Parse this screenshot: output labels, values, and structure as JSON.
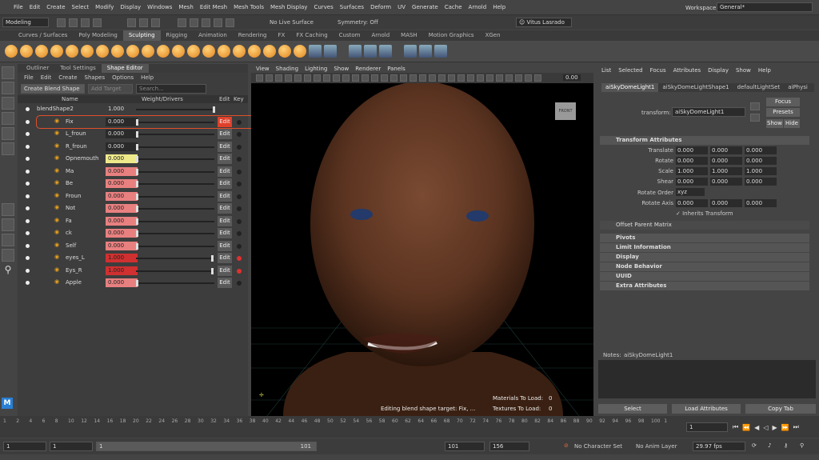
{
  "menubar": {
    "items": [
      "File",
      "Edit",
      "Create",
      "Select",
      "Modify",
      "Display",
      "Windows",
      "Mesh",
      "Edit Mesh",
      "Mesh Tools",
      "Mesh Display",
      "Curves",
      "Surfaces",
      "Deform",
      "UV",
      "Generate",
      "Cache",
      "Arnold",
      "Help"
    ],
    "workspace_label": "Workspace:",
    "workspace_value": "General*"
  },
  "statusline": {
    "mode": "Modeling",
    "live_surface": "No Live Surface",
    "symmetry": "Symmetry: Off",
    "user": "Vitus Lasrado"
  },
  "shelf_tabs": [
    "Curves / Surfaces",
    "Poly Modeling",
    "Sculpting",
    "Rigging",
    "Animation",
    "Rendering",
    "FX",
    "FX Caching",
    "Custom",
    "Arnold",
    "MASH",
    "Motion Graphics",
    "XGen"
  ],
  "shelf_active": "Sculpting",
  "panel": {
    "tabs": [
      "Outliner",
      "Tool Settings",
      "Shape Editor"
    ],
    "active_tab": "Shape Editor",
    "menu": [
      "File",
      "Edit",
      "Create",
      "Shapes",
      "Options",
      "Help"
    ],
    "create_button": "Create Blend Shape",
    "add_target_button": "Add Target",
    "search_placeholder": "Search...",
    "headers": {
      "name": "Name",
      "weight": "Weight/Drivers",
      "edit": "Edit",
      "key": "Key"
    },
    "blendshape": {
      "name": "blendShape2",
      "value": "1.000"
    },
    "targets": [
      {
        "name": "Fix",
        "value": "0.000",
        "color": "#2a2a2a",
        "edit_active": true
      },
      {
        "name": "L_froun",
        "value": "0.000",
        "color": "#2a2a2a"
      },
      {
        "name": "R_froun",
        "value": "0.000",
        "color": "#2a2a2a"
      },
      {
        "name": "Opnemouth",
        "value": "0.000",
        "color": "#eeea8a"
      },
      {
        "name": "Ma",
        "value": "0.000",
        "color": "#e88080"
      },
      {
        "name": "Be",
        "value": "0.000",
        "color": "#e88080"
      },
      {
        "name": "Froun",
        "value": "0.000",
        "color": "#e88080"
      },
      {
        "name": "Not",
        "value": "0.000",
        "color": "#e88080"
      },
      {
        "name": "Fa",
        "value": "0.000",
        "color": "#e88080"
      },
      {
        "name": "ck",
        "value": "0.000",
        "color": "#e88080"
      },
      {
        "name": "Self",
        "value": "0.000",
        "color": "#e88080"
      },
      {
        "name": "eyes_L",
        "value": "1.000",
        "color": "#d03030",
        "key_red": true
      },
      {
        "name": "Eys_R",
        "value": "1.000",
        "color": "#d03030",
        "key_red": true
      },
      {
        "name": "Apple",
        "value": "0.000",
        "color": "#e88080"
      }
    ],
    "edit_label": "Edit"
  },
  "viewport": {
    "menu": [
      "View",
      "Shading",
      "Lighting",
      "Show",
      "Renderer",
      "Panels"
    ],
    "zoom_value": "0.00",
    "cube_label": "FRONT",
    "status_text": "Editing blend shape target: Fix, ...",
    "materials_label": "Materials To Load:",
    "materials_value": "0",
    "textures_label": "Textures To Load:",
    "textures_value": "0"
  },
  "attr": {
    "menu": [
      "List",
      "Selected",
      "Focus",
      "Attributes",
      "Display",
      "Show",
      "Help"
    ],
    "tabs": [
      "aiSkyDomeLight1",
      "aiSkyDomeLightShape1",
      "defaultLightSet",
      "aiPhysi"
    ],
    "transform_label": "transform:",
    "transform_value": "aiSkyDomeLight1",
    "focus": "Focus",
    "presets": "Presets",
    "show": "Show",
    "hide": "Hide",
    "section_transform": "Transform Attributes",
    "rows": [
      {
        "label": "Translate",
        "v": [
          "0.000",
          "0.000",
          "0.000"
        ]
      },
      {
        "label": "Rotate",
        "v": [
          "0.000",
          "0.000",
          "0.000"
        ]
      },
      {
        "label": "Scale",
        "v": [
          "1.000",
          "1.000",
          "1.000"
        ]
      },
      {
        "label": "Shear",
        "v": [
          "0.000",
          "0.000",
          "0.000"
        ]
      }
    ],
    "rotate_order_label": "Rotate Order",
    "rotate_order_value": "xyz",
    "rotate_axis_label": "Rotate Axis",
    "rotate_axis": [
      "0.000",
      "0.000",
      "0.000"
    ],
    "inherits": "Inherits Transform",
    "offset_parent": "Offset Parent Matrix",
    "sections": [
      "Pivots",
      "Limit Information",
      "Display",
      "Node Behavior",
      "UUID",
      "Extra Attributes"
    ],
    "notes_label": "Notes:",
    "notes_value": "aiSkyDomeLight1",
    "select_btn": "Select",
    "load_btn": "Load Attributes",
    "copy_btn": "Copy Tab"
  },
  "timeline": {
    "ticks": [
      "1",
      "2",
      "4",
      "6",
      "8",
      "10",
      "12",
      "14",
      "16",
      "18",
      "20",
      "22",
      "24",
      "26",
      "28",
      "30",
      "32",
      "34",
      "36",
      "38",
      "40",
      "42",
      "44",
      "46",
      "48",
      "50",
      "52",
      "54",
      "56",
      "58",
      "60",
      "62",
      "64",
      "66",
      "68",
      "70",
      "72",
      "74",
      "76",
      "78",
      "80",
      "82",
      "84",
      "86",
      "88",
      "90",
      "92",
      "94",
      "96",
      "98",
      "100",
      "1"
    ],
    "current": "1"
  },
  "range": {
    "start": "1",
    "start2": "1",
    "range_start": "1",
    "range_end": "101",
    "end": "101",
    "end2": "156",
    "character_set": "No Character Set",
    "anim_layer": "No Anim Layer",
    "fps": "29.97 fps"
  }
}
